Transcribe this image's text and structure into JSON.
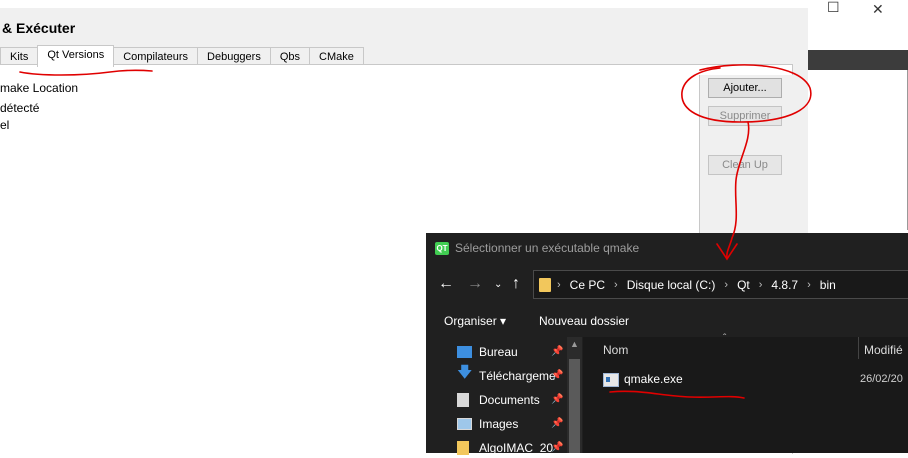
{
  "options_window": {
    "title": "& Exécuter",
    "tabs": [
      "Kits",
      "Qt Versions",
      "Compilateurs",
      "Debuggers",
      "Qbs",
      "CMake"
    ],
    "active_tab": "Qt Versions",
    "tree_lines": [
      "make Location",
      "détecté",
      "el"
    ],
    "buttons": {
      "add": "Ajouter...",
      "remove": "Supprimer",
      "cleanup": "Clean Up"
    }
  },
  "background_window": {
    "minimize": "—",
    "maximize": "☐",
    "close": "✕"
  },
  "file_dialog": {
    "title": "Sélectionner un exécutable qmake",
    "logo_text": "QT",
    "address": [
      "Ce PC",
      "Disque local (C:)",
      "Qt",
      "4.8.7",
      "bin"
    ],
    "toolbar": {
      "organize": "Organiser ▾",
      "new_folder": "Nouveau dossier"
    },
    "nav_items": [
      "Bureau",
      "Téléchargeme",
      "Documents",
      "Images",
      "AlgoIMAC_20"
    ],
    "columns": {
      "name": "Nom",
      "modified": "Modifié"
    },
    "files": [
      {
        "name": "qmake.exe",
        "date": "26/02/20"
      }
    ]
  },
  "colors": {
    "annotation_red": "#e00000",
    "dialog_bg": "#202020",
    "qt_green": "#41cd52"
  }
}
